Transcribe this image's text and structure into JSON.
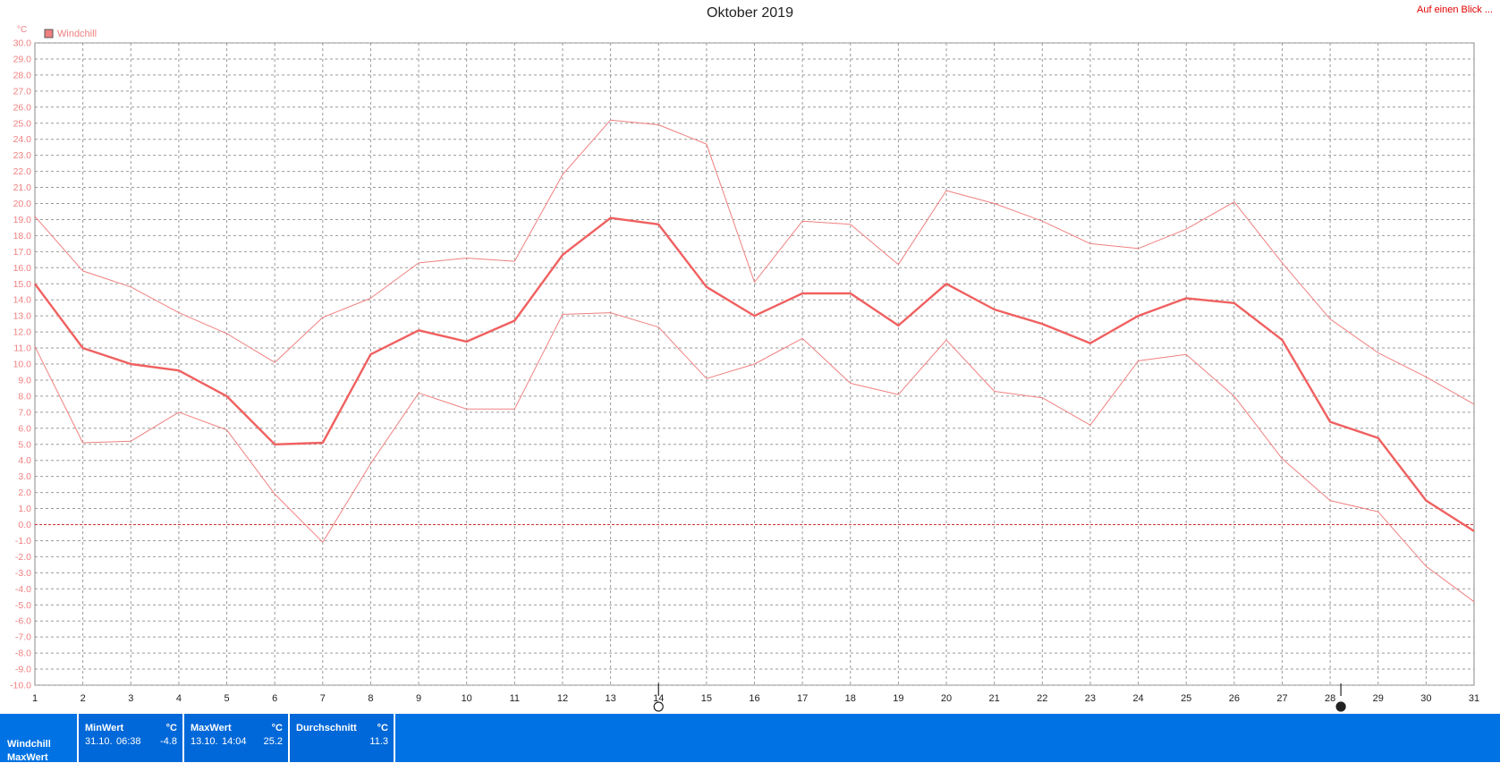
{
  "window": {
    "title": "Oktober 2019",
    "glance_link": "Auf einen Blick ..."
  },
  "chart_data": {
    "type": "line",
    "title": "Oktober 2019",
    "ylabel": "°C",
    "ylim": [
      -10,
      30
    ],
    "ytick_step": 1,
    "categories": [
      "1",
      "2",
      "3",
      "4",
      "5",
      "6",
      "7",
      "8",
      "9",
      "10",
      "11",
      "12",
      "13",
      "14",
      "15",
      "16",
      "17",
      "18",
      "19",
      "20",
      "21",
      "22",
      "23",
      "24",
      "25",
      "26",
      "27",
      "28",
      "29",
      "30",
      "31"
    ],
    "legend": {
      "label": "Windchill",
      "placement": "top-left",
      "color": "#f08080"
    },
    "grid": true,
    "zero_line_color": "#cc3333",
    "series": [
      {
        "name": "Windchill",
        "role": "max",
        "color": "#f08080",
        "values": [
          19.2,
          15.8,
          14.8,
          13.2,
          11.9,
          10.1,
          12.9,
          14.1,
          16.3,
          16.6,
          16.4,
          21.8,
          25.2,
          24.9,
          23.7,
          15.1,
          18.9,
          18.7,
          16.2,
          20.8,
          20.0,
          18.9,
          17.5,
          17.2,
          18.4,
          20.1,
          16.3,
          12.8,
          10.7,
          9.2,
          7.5
        ]
      },
      {
        "name": "Windchill",
        "role": "avg",
        "color": "#f06060",
        "values": [
          15.0,
          11.0,
          10.0,
          9.6,
          8.0,
          5.0,
          5.1,
          10.6,
          12.1,
          11.4,
          12.7,
          16.8,
          19.1,
          18.7,
          14.8,
          13.0,
          14.4,
          14.4,
          12.4,
          15.0,
          13.4,
          12.5,
          11.3,
          13.0,
          14.1,
          13.8,
          11.5,
          6.4,
          5.4,
          1.5,
          -0.4
        ]
      },
      {
        "name": "Windchill",
        "role": "min",
        "color": "#f08080",
        "values": [
          11.1,
          5.1,
          5.2,
          7.0,
          5.9,
          1.9,
          -1.1,
          3.8,
          8.2,
          7.2,
          7.2,
          13.1,
          13.2,
          12.3,
          9.1,
          10.0,
          11.6,
          8.8,
          8.1,
          11.5,
          8.3,
          7.9,
          6.2,
          10.2,
          10.6,
          8.0,
          4.1,
          1.5,
          0.8,
          -2.6,
          -4.8
        ]
      }
    ],
    "markers": [
      {
        "day": "14",
        "symbol": "full-moon-icon"
      },
      {
        "day": "28",
        "symbol": "new-moon-icon"
      }
    ]
  },
  "footer": {
    "row_labels": [
      "Windchill",
      "MaxWert"
    ],
    "min": {
      "header": "MinWert",
      "unit": "°C",
      "date": "31.10.",
      "time": "06:38",
      "value": "-4.8"
    },
    "max": {
      "header": "MaxWert",
      "unit": "°C",
      "date": "13.10.",
      "time": "14:04",
      "value": "25.2"
    },
    "avg": {
      "header": "Durchschnitt",
      "unit": "°C",
      "value": "11.3"
    }
  }
}
